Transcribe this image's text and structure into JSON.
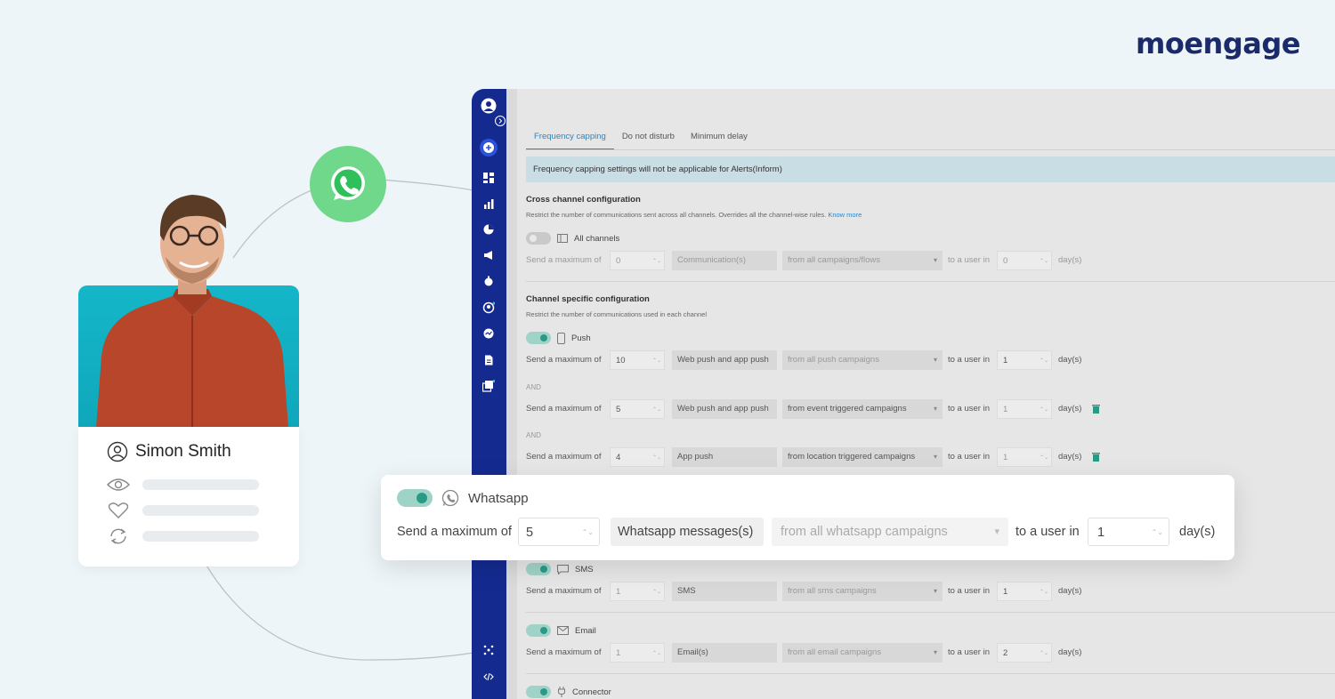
{
  "brand": {
    "logo_text": "moengage",
    "accent": "#142a8f",
    "whatsapp_green": "#6fd88a",
    "teal": "#2a9a87"
  },
  "profile": {
    "name": "Simon Smith",
    "icons": [
      "eye-icon",
      "heart-icon",
      "refresh-icon"
    ]
  },
  "tabs": [
    {
      "label": "Frequency capping",
      "active": true
    },
    {
      "label": "Do not disturb",
      "active": false
    },
    {
      "label": "Minimum delay",
      "active": false
    }
  ],
  "notice": "Frequency capping settings will not be applicable for Alerts(Inform)",
  "cross_channel": {
    "title": "Cross channel configuration",
    "subtitle": "Restrict the number of communications sent across all channels. Overrides all the channel-wise rules.",
    "link": "Know more",
    "channel": "All channels",
    "row": {
      "label": "Send a maximum of",
      "count": "0",
      "unit": "Communication(s)",
      "source": "from all campaigns/flows",
      "to": "to a user in",
      "days": "0",
      "days_label": "day(s)"
    }
  },
  "channel_specific": {
    "title": "Channel specific configuration",
    "subtitle": "Restrict the number of communications used in each channel",
    "and_label": "AND",
    "push": {
      "channel": "Push",
      "rows": [
        {
          "label": "Send a maximum of",
          "count": "10",
          "unit": "Web push and app push",
          "source": "from all push campaigns",
          "to": "to a user in",
          "days": "1",
          "days_label": "day(s)"
        },
        {
          "label": "Send a maximum of",
          "count": "5",
          "unit": "Web push and app push",
          "source": "from event triggered campaigns",
          "to": "to a user in",
          "days": "1",
          "days_label": "day(s)"
        },
        {
          "label": "Send a maximum of",
          "count": "4",
          "unit": "App push",
          "source": "from location triggered campaigns",
          "to": "to a user in",
          "days": "1",
          "days_label": "day(s)"
        }
      ]
    },
    "sms": {
      "channel": "SMS",
      "row": {
        "label": "Send a maximum of",
        "count": "1",
        "unit": "SMS",
        "source": "from all sms campaigns",
        "to": "to a user in",
        "days": "1",
        "days_label": "day(s)"
      }
    },
    "email": {
      "channel": "Email",
      "row": {
        "label": "Send a maximum of",
        "count": "1",
        "unit": "Email(s)",
        "source": "from all email campaigns",
        "to": "to a user in",
        "days": "2",
        "days_label": "day(s)"
      }
    },
    "connector": {
      "channel": "Connector"
    }
  },
  "whatsapp": {
    "channel": "Whatsapp",
    "row": {
      "label": "Send a maximum of",
      "count": "5",
      "unit": "Whatsapp messages(s)",
      "source": "from all whatsapp campaigns",
      "to": "to a user in",
      "days": "1",
      "days_label": "day(s)"
    }
  }
}
